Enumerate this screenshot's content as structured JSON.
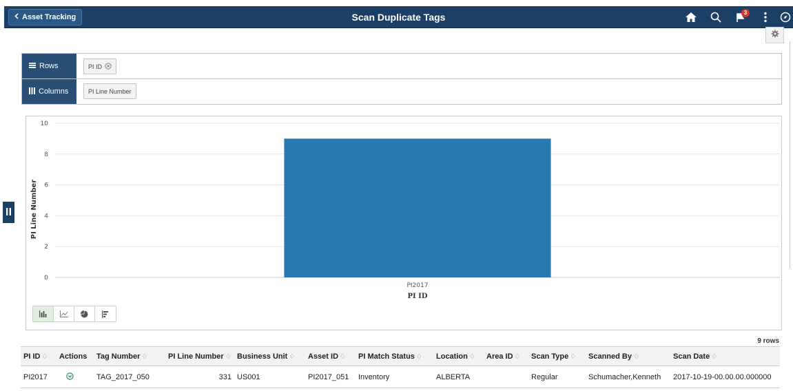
{
  "header": {
    "back_label": "Asset Tracking",
    "title": "Scan Duplicate Tags",
    "notification_count": "3",
    "icons": [
      "home-icon",
      "search-icon",
      "flag-icon",
      "more-icon",
      "navbar-icon"
    ]
  },
  "pivot": {
    "rows_label": "Rows",
    "rows_chip": "PI ID",
    "columns_label": "Columns",
    "columns_chip": "PI Line Number"
  },
  "chart_data": {
    "type": "bar",
    "categories": [
      "PI2017"
    ],
    "values": [
      9
    ],
    "xlabel": "PI ID",
    "ylabel": "PI Line Number",
    "ylim": [
      0,
      10
    ],
    "yticks": [
      0,
      2,
      4,
      6,
      8,
      10
    ],
    "grid": true,
    "bar_color": "#2a78b0"
  },
  "chart_types": [
    "bar-chart-icon",
    "line-chart-icon",
    "pie-chart-icon",
    "horizontal-bar-icon"
  ],
  "grid": {
    "row_count": "9 rows",
    "columns": [
      "PI ID",
      "Actions",
      "Tag Number",
      "PI Line Number",
      "Business Unit",
      "Asset ID",
      "PI Match Status",
      "Location",
      "Area ID",
      "Scan Type",
      "Scanned By",
      "Scan Date"
    ],
    "rows": [
      [
        "PI2017",
        "",
        "TAG_2017_050",
        "331",
        "US001",
        "PI2017_051",
        "Inventory",
        "ALBERTA",
        "",
        "Regular",
        "Schumacher,Kenneth",
        "2017-10-19-00.00.00.000000"
      ]
    ]
  },
  "colors": {
    "banner": "#1c3f66",
    "pivot_label": "#2a4f77",
    "bar": "#2a78b0",
    "badge": "#d6342c"
  }
}
